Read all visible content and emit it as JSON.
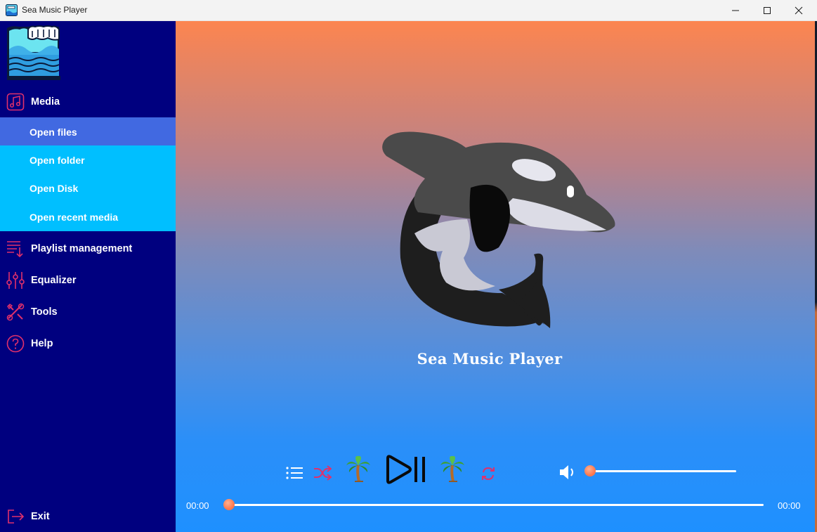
{
  "window": {
    "title": "Sea Music Player",
    "icon": "wave-app-icon",
    "controls": [
      "minimize-icon",
      "maximize-icon",
      "close-icon"
    ]
  },
  "sidebar": {
    "logo": "wave-logo",
    "menu": [
      {
        "label": "Media",
        "icon": "music-note-icon"
      },
      {
        "label": "Playlist management",
        "icon": "playlist-icon"
      },
      {
        "label": "Equalizer",
        "icon": "equalizer-icon"
      },
      {
        "label": "Tools",
        "icon": "tools-icon"
      },
      {
        "label": "Help",
        "icon": "help-icon"
      }
    ],
    "media_submenu": [
      {
        "label": "Open files",
        "active": true
      },
      {
        "label": "Open folder",
        "active": false
      },
      {
        "label": "Open Disk",
        "active": false
      },
      {
        "label": "Open recent media",
        "active": false
      }
    ],
    "exit": {
      "label": "Exit",
      "icon": "exit-icon"
    }
  },
  "main": {
    "artwork": "orca-icon",
    "app_name": "Sea Music Player"
  },
  "player": {
    "buttons": [
      "playlist-icon",
      "shuffle-icon",
      "palm-tree-icon",
      "play-pause-icon",
      "palm-tree-icon",
      "repeat-icon"
    ],
    "volume_icon": "speaker-icon",
    "volume_level": 0,
    "position": 0,
    "current_time": "00:00",
    "total_time": "00:00"
  },
  "colors": {
    "sidebar_bg": "#00007f",
    "submenu_bg": "#00bfff",
    "submenu_active": "#4169e1",
    "icon_accent": "#e0306b",
    "gradient_top": "#fc8550",
    "gradient_bottom": "#1e90ff",
    "slider_knob": "#ff7a50"
  }
}
